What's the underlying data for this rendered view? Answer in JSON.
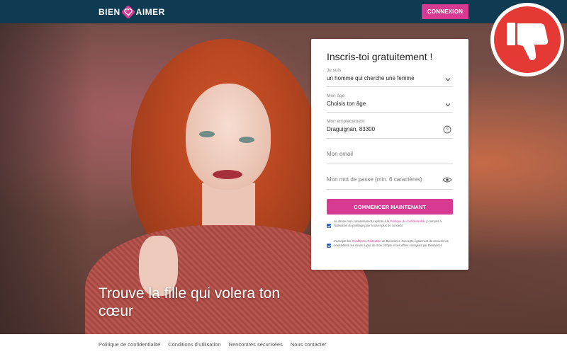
{
  "header": {
    "logo_left": "BIEN",
    "logo_right": "AIMER",
    "login_button": "CONNEXION"
  },
  "hero": {
    "title": "Trouve la fille qui volera ton cœur"
  },
  "form": {
    "title": "Inscris-toi gratuitement !",
    "gender": {
      "label": "Je suis",
      "value": "un homme qui cherche une femme"
    },
    "age": {
      "label": "Mon âge",
      "value": "Choisis ton âge"
    },
    "location": {
      "label": "Mon emplacement",
      "value": "Draguignan, 83300"
    },
    "email": {
      "placeholder": "Mon email"
    },
    "password": {
      "placeholder": "Mon mot de passe (min. 6 caractères)"
    },
    "submit_button": "COMMENCER MAINTENANT",
    "consent1": {
      "before": "Je donne mon consentement explicite à la ",
      "link": "Politique de confidentialité",
      "after": ", y compris à l'utilisation du profilage pour trouver plus de contacts"
    },
    "consent2": {
      "before": "J'accepte les ",
      "link": "Conditions d'utilisation",
      "after": " de BienAimer. J'accepte également de recevoir les newsletters, les mises à jour de mon compte et les offres envoyées par BienAimer."
    }
  },
  "footer": {
    "links": [
      "Politique de confidentialité",
      "Conditions d'utilisation",
      "Rencontres sécurisées",
      "Nous contacter"
    ]
  },
  "colors": {
    "topbar": "#0e3a52",
    "accent": "#d63a92",
    "thumbs_badge": "#e53935"
  },
  "icons": [
    "heart-logo-icon",
    "chevron-down-icon",
    "question-icon",
    "eye-icon",
    "thumbs-down-icon"
  ]
}
